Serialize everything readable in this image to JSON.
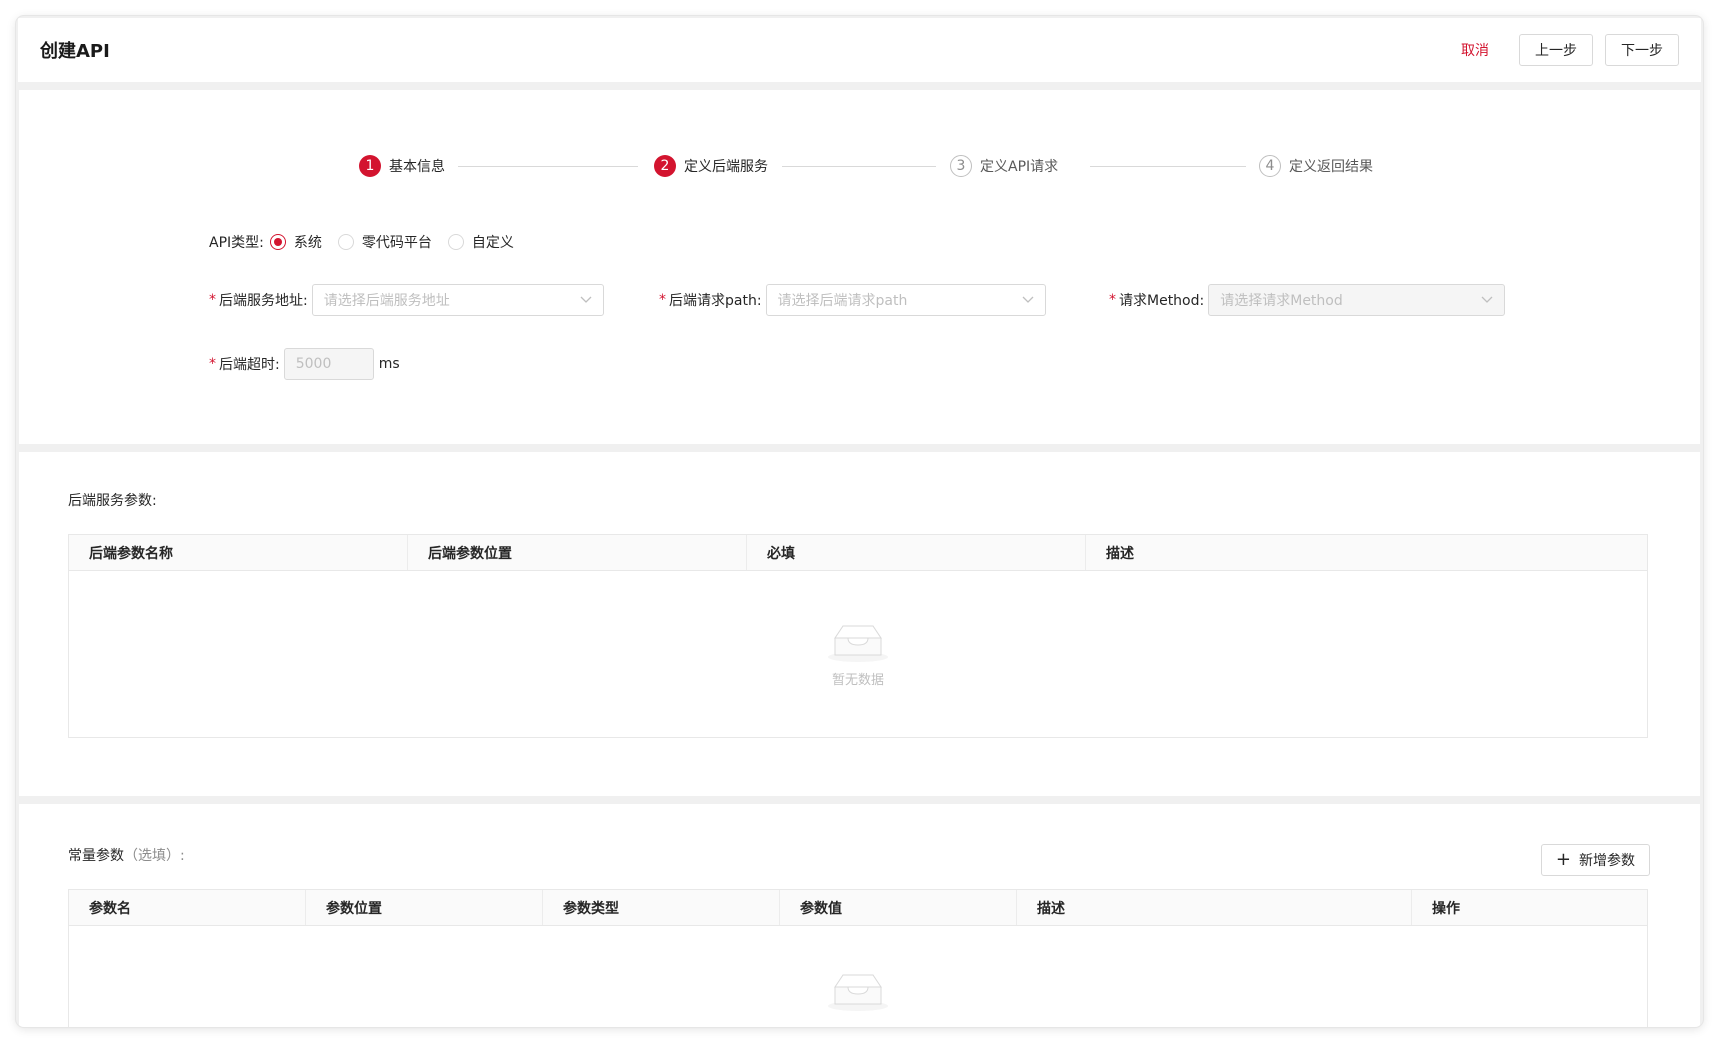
{
  "header": {
    "title": "创建API",
    "cancel_label": "取消",
    "prev_label": "上一步",
    "next_label": "下一步"
  },
  "steps": [
    {
      "num": "1",
      "label": "基本信息",
      "status": "done"
    },
    {
      "num": "2",
      "label": "定义后端服务",
      "status": "active"
    },
    {
      "num": "3",
      "label": "定义API请求",
      "status": "wait"
    },
    {
      "num": "4",
      "label": "定义返回结果",
      "status": "wait"
    }
  ],
  "form": {
    "api_type_label": "API类型:",
    "api_type_options": [
      "系统",
      "零代码平台",
      "自定义"
    ],
    "api_type_selected": "系统",
    "backend_address": {
      "label": "后端服务地址:",
      "placeholder": "请选择后端服务地址"
    },
    "backend_path": {
      "label": "后端请求path:",
      "placeholder": "请选择后端请求path"
    },
    "method": {
      "label": "请求Method:",
      "placeholder": "请选择请求Method"
    },
    "timeout": {
      "label": "后端超时:",
      "value": "5000",
      "unit": "ms"
    },
    "required_mark": "*"
  },
  "backend_params": {
    "title": "后端服务参数:",
    "columns": [
      "后端参数名称",
      "后端参数位置",
      "必填",
      "描述"
    ],
    "empty_text": "暂无数据"
  },
  "const_params": {
    "title": "常量参数",
    "title_optional": "（选填）:",
    "add_label": "新增参数",
    "columns": [
      "参数名",
      "参数位置",
      "参数类型",
      "参数值",
      "描述",
      "操作"
    ]
  },
  "colors": {
    "accent": "#d3142f"
  }
}
